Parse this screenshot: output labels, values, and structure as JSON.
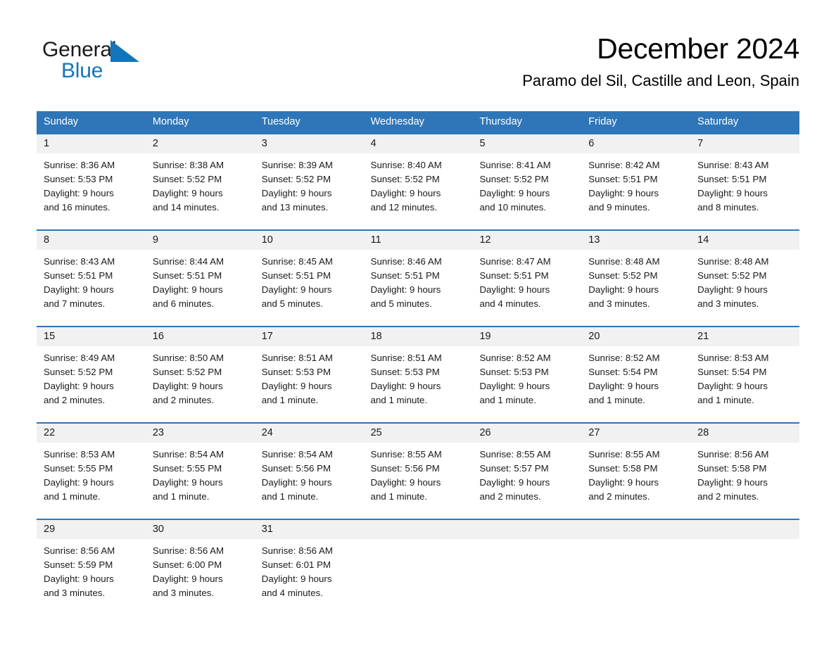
{
  "brand": {
    "name_part1": "General",
    "name_part2": "Blue",
    "logo_icon": "triangle-icon",
    "accent_color": "#1275bc"
  },
  "header": {
    "title": "December 2024",
    "subtitle": "Paramo del Sil, Castille and Leon, Spain"
  },
  "theme": {
    "header_blue": "#2e76b8",
    "row_band_gray": "#f1f1f1",
    "text_color": "#1a1a1a"
  },
  "weekdays": [
    "Sunday",
    "Monday",
    "Tuesday",
    "Wednesday",
    "Thursday",
    "Friday",
    "Saturday"
  ],
  "weeks": [
    {
      "daynums": [
        "1",
        "2",
        "3",
        "4",
        "5",
        "6",
        "7"
      ],
      "cells": [
        {
          "sunrise": "Sunrise: 8:36 AM",
          "sunset": "Sunset: 5:53 PM",
          "daylight_line1": "Daylight: 9 hours",
          "daylight_line2": "and 16 minutes."
        },
        {
          "sunrise": "Sunrise: 8:38 AM",
          "sunset": "Sunset: 5:52 PM",
          "daylight_line1": "Daylight: 9 hours",
          "daylight_line2": "and 14 minutes."
        },
        {
          "sunrise": "Sunrise: 8:39 AM",
          "sunset": "Sunset: 5:52 PM",
          "daylight_line1": "Daylight: 9 hours",
          "daylight_line2": "and 13 minutes."
        },
        {
          "sunrise": "Sunrise: 8:40 AM",
          "sunset": "Sunset: 5:52 PM",
          "daylight_line1": "Daylight: 9 hours",
          "daylight_line2": "and 12 minutes."
        },
        {
          "sunrise": "Sunrise: 8:41 AM",
          "sunset": "Sunset: 5:52 PM",
          "daylight_line1": "Daylight: 9 hours",
          "daylight_line2": "and 10 minutes."
        },
        {
          "sunrise": "Sunrise: 8:42 AM",
          "sunset": "Sunset: 5:51 PM",
          "daylight_line1": "Daylight: 9 hours",
          "daylight_line2": "and 9 minutes."
        },
        {
          "sunrise": "Sunrise: 8:43 AM",
          "sunset": "Sunset: 5:51 PM",
          "daylight_line1": "Daylight: 9 hours",
          "daylight_line2": "and 8 minutes."
        }
      ]
    },
    {
      "daynums": [
        "8",
        "9",
        "10",
        "11",
        "12",
        "13",
        "14"
      ],
      "cells": [
        {
          "sunrise": "Sunrise: 8:43 AM",
          "sunset": "Sunset: 5:51 PM",
          "daylight_line1": "Daylight: 9 hours",
          "daylight_line2": "and 7 minutes."
        },
        {
          "sunrise": "Sunrise: 8:44 AM",
          "sunset": "Sunset: 5:51 PM",
          "daylight_line1": "Daylight: 9 hours",
          "daylight_line2": "and 6 minutes."
        },
        {
          "sunrise": "Sunrise: 8:45 AM",
          "sunset": "Sunset: 5:51 PM",
          "daylight_line1": "Daylight: 9 hours",
          "daylight_line2": "and 5 minutes."
        },
        {
          "sunrise": "Sunrise: 8:46 AM",
          "sunset": "Sunset: 5:51 PM",
          "daylight_line1": "Daylight: 9 hours",
          "daylight_line2": "and 5 minutes."
        },
        {
          "sunrise": "Sunrise: 8:47 AM",
          "sunset": "Sunset: 5:51 PM",
          "daylight_line1": "Daylight: 9 hours",
          "daylight_line2": "and 4 minutes."
        },
        {
          "sunrise": "Sunrise: 8:48 AM",
          "sunset": "Sunset: 5:52 PM",
          "daylight_line1": "Daylight: 9 hours",
          "daylight_line2": "and 3 minutes."
        },
        {
          "sunrise": "Sunrise: 8:48 AM",
          "sunset": "Sunset: 5:52 PM",
          "daylight_line1": "Daylight: 9 hours",
          "daylight_line2": "and 3 minutes."
        }
      ]
    },
    {
      "daynums": [
        "15",
        "16",
        "17",
        "18",
        "19",
        "20",
        "21"
      ],
      "cells": [
        {
          "sunrise": "Sunrise: 8:49 AM",
          "sunset": "Sunset: 5:52 PM",
          "daylight_line1": "Daylight: 9 hours",
          "daylight_line2": "and 2 minutes."
        },
        {
          "sunrise": "Sunrise: 8:50 AM",
          "sunset": "Sunset: 5:52 PM",
          "daylight_line1": "Daylight: 9 hours",
          "daylight_line2": "and 2 minutes."
        },
        {
          "sunrise": "Sunrise: 8:51 AM",
          "sunset": "Sunset: 5:53 PM",
          "daylight_line1": "Daylight: 9 hours",
          "daylight_line2": "and 1 minute."
        },
        {
          "sunrise": "Sunrise: 8:51 AM",
          "sunset": "Sunset: 5:53 PM",
          "daylight_line1": "Daylight: 9 hours",
          "daylight_line2": "and 1 minute."
        },
        {
          "sunrise": "Sunrise: 8:52 AM",
          "sunset": "Sunset: 5:53 PM",
          "daylight_line1": "Daylight: 9 hours",
          "daylight_line2": "and 1 minute."
        },
        {
          "sunrise": "Sunrise: 8:52 AM",
          "sunset": "Sunset: 5:54 PM",
          "daylight_line1": "Daylight: 9 hours",
          "daylight_line2": "and 1 minute."
        },
        {
          "sunrise": "Sunrise: 8:53 AM",
          "sunset": "Sunset: 5:54 PM",
          "daylight_line1": "Daylight: 9 hours",
          "daylight_line2": "and 1 minute."
        }
      ]
    },
    {
      "daynums": [
        "22",
        "23",
        "24",
        "25",
        "26",
        "27",
        "28"
      ],
      "cells": [
        {
          "sunrise": "Sunrise: 8:53 AM",
          "sunset": "Sunset: 5:55 PM",
          "daylight_line1": "Daylight: 9 hours",
          "daylight_line2": "and 1 minute."
        },
        {
          "sunrise": "Sunrise: 8:54 AM",
          "sunset": "Sunset: 5:55 PM",
          "daylight_line1": "Daylight: 9 hours",
          "daylight_line2": "and 1 minute."
        },
        {
          "sunrise": "Sunrise: 8:54 AM",
          "sunset": "Sunset: 5:56 PM",
          "daylight_line1": "Daylight: 9 hours",
          "daylight_line2": "and 1 minute."
        },
        {
          "sunrise": "Sunrise: 8:55 AM",
          "sunset": "Sunset: 5:56 PM",
          "daylight_line1": "Daylight: 9 hours",
          "daylight_line2": "and 1 minute."
        },
        {
          "sunrise": "Sunrise: 8:55 AM",
          "sunset": "Sunset: 5:57 PM",
          "daylight_line1": "Daylight: 9 hours",
          "daylight_line2": "and 2 minutes."
        },
        {
          "sunrise": "Sunrise: 8:55 AM",
          "sunset": "Sunset: 5:58 PM",
          "daylight_line1": "Daylight: 9 hours",
          "daylight_line2": "and 2 minutes."
        },
        {
          "sunrise": "Sunrise: 8:56 AM",
          "sunset": "Sunset: 5:58 PM",
          "daylight_line1": "Daylight: 9 hours",
          "daylight_line2": "and 2 minutes."
        }
      ]
    },
    {
      "daynums": [
        "29",
        "30",
        "31",
        "",
        "",
        "",
        ""
      ],
      "cells": [
        {
          "sunrise": "Sunrise: 8:56 AM",
          "sunset": "Sunset: 5:59 PM",
          "daylight_line1": "Daylight: 9 hours",
          "daylight_line2": "and 3 minutes."
        },
        {
          "sunrise": "Sunrise: 8:56 AM",
          "sunset": "Sunset: 6:00 PM",
          "daylight_line1": "Daylight: 9 hours",
          "daylight_line2": "and 3 minutes."
        },
        {
          "sunrise": "Sunrise: 8:56 AM",
          "sunset": "Sunset: 6:01 PM",
          "daylight_line1": "Daylight: 9 hours",
          "daylight_line2": "and 4 minutes."
        },
        {
          "sunrise": "",
          "sunset": "",
          "daylight_line1": "",
          "daylight_line2": ""
        },
        {
          "sunrise": "",
          "sunset": "",
          "daylight_line1": "",
          "daylight_line2": ""
        },
        {
          "sunrise": "",
          "sunset": "",
          "daylight_line1": "",
          "daylight_line2": ""
        },
        {
          "sunrise": "",
          "sunset": "",
          "daylight_line1": "",
          "daylight_line2": ""
        }
      ]
    }
  ]
}
